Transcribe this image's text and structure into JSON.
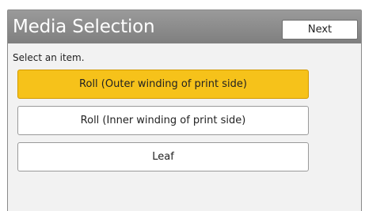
{
  "header": {
    "title": "Media Selection",
    "next_label": "Next"
  },
  "main": {
    "prompt": "Select an item.",
    "options": [
      {
        "label": "Roll (Outer winding of print side)",
        "selected": true
      },
      {
        "label": "Roll (Inner winding of print side)",
        "selected": false
      },
      {
        "label": "Leaf",
        "selected": false
      }
    ]
  },
  "colors": {
    "header_bg": "#8c8c8c",
    "selected_bg": "#f6c21a",
    "panel_bg": "#f2f2f2"
  }
}
